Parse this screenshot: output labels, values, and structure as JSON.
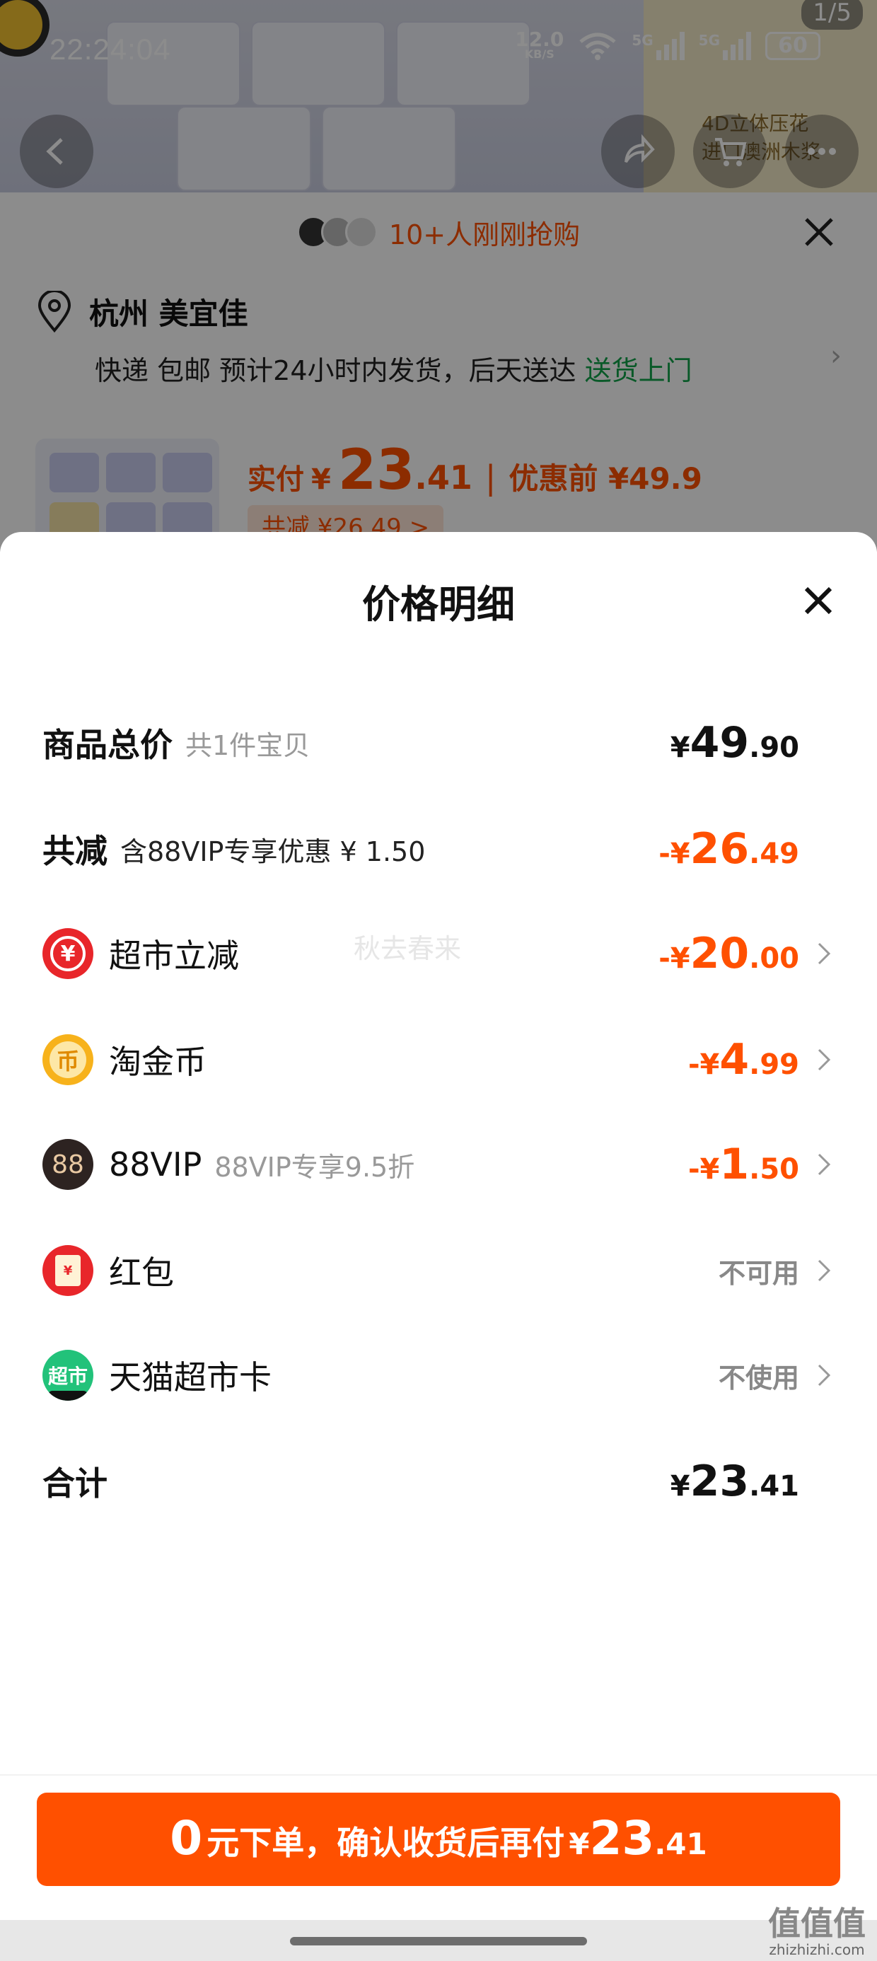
{
  "status_bar": {
    "time": "22:24:04",
    "net_speed": "12.0",
    "net_unit": "KB/S",
    "sig1": "5G",
    "sig2": "5G",
    "battery": "60"
  },
  "banner": {
    "counter": "1/5",
    "side_text_1": "4D立体压花",
    "side_text_2": "进口澳洲木浆"
  },
  "buyers": {
    "text": "10+人刚刚抢购"
  },
  "address": {
    "city": "杭州 美宜佳",
    "delivery": "快递 包邮 预计24小时内发货，后天送达",
    "door": "送货上门"
  },
  "product": {
    "paid_label": "实付",
    "currency": "¥",
    "price_int": "23",
    "price_dec": ".41",
    "before_label": "优惠前 ¥49.9",
    "discount_chip": "共减 ¥26.49 >"
  },
  "sheet": {
    "title": "价格明细",
    "watermark": "秋去春来",
    "rows": {
      "total": {
        "label": "商品总价",
        "sub": "共1件宝贝",
        "cur": "¥",
        "amt": "49",
        "dec": ".90"
      },
      "reduce": {
        "label": "共减",
        "sub": "含88VIP专享优惠 ¥ 1.50",
        "cur": "-¥",
        "amt": "26",
        "dec": ".49"
      },
      "market": {
        "label": "超市立减",
        "icon_glyph": "¥",
        "cur": "-¥",
        "amt": "20",
        "dec": ".00"
      },
      "coin": {
        "label": "淘金币",
        "icon_glyph": "币",
        "cur": "-¥",
        "amt": "4",
        "dec": ".99"
      },
      "vip": {
        "label": "88VIP",
        "icon_glyph": "88",
        "sub": "88VIP专享9.5折",
        "cur": "-¥",
        "amt": "1",
        "dec": ".50"
      },
      "hongbao": {
        "label": "红包",
        "icon_glyph": "¥",
        "status": "不可用"
      },
      "card": {
        "label": "天猫超市卡",
        "icon_glyph": "超市",
        "status": "不使用"
      },
      "sum": {
        "label": "合计",
        "cur": "¥",
        "amt": "23",
        "dec": ".41"
      }
    }
  },
  "cta": {
    "zero": "0",
    "text": "元下单，确认收货后再付",
    "cur": "¥",
    "amt": "23",
    "dec": ".41"
  },
  "site_mark": {
    "logo": "值值值",
    "url": "zhizhizhi.com"
  }
}
